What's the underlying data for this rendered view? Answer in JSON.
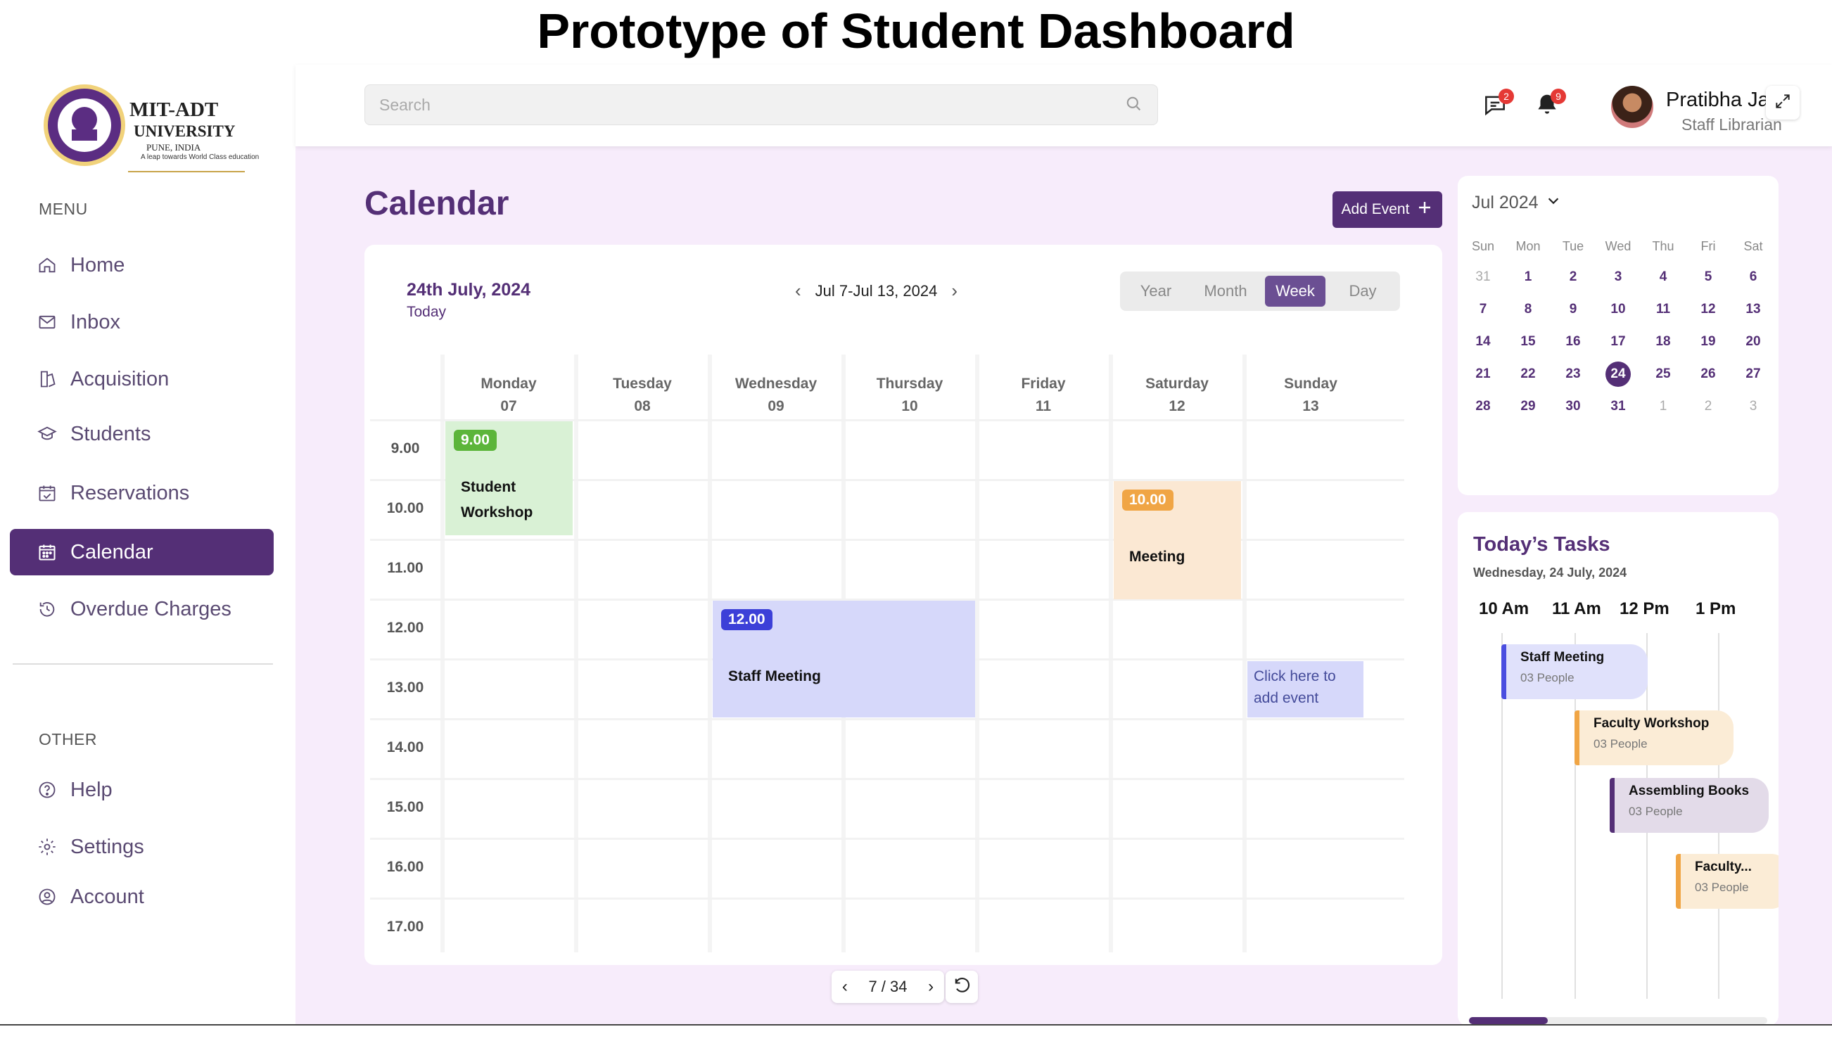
{
  "page_title": "Prototype of Student Dashboard",
  "logo": {
    "name_line1": "MIT-ADT",
    "name_line2": "UNIVERSITY",
    "location": "PUNE, INDIA",
    "tagline": "A leap towards World Class education",
    "seal_text": "MIT UNIVERSITY"
  },
  "sidebar": {
    "menu_heading": "MENU",
    "items": [
      {
        "label": "Home",
        "icon": "home-icon"
      },
      {
        "label": "Inbox",
        "icon": "mail-icon"
      },
      {
        "label": "Acquisition",
        "icon": "acquisition-icon"
      },
      {
        "label": "Students",
        "icon": "graduation-cap-icon"
      },
      {
        "label": "Reservations",
        "icon": "calendar-check-icon"
      },
      {
        "label": "Calendar",
        "icon": "calendar-icon",
        "active": true
      },
      {
        "label": "Overdue Charges",
        "icon": "clock-history-icon"
      }
    ],
    "other_heading": "OTHER",
    "other_items": [
      {
        "label": "Help",
        "icon": "help-icon"
      },
      {
        "label": "Settings",
        "icon": "gear-icon"
      },
      {
        "label": "Account",
        "icon": "user-circle-icon"
      }
    ]
  },
  "topbar": {
    "search_placeholder": "Search",
    "messages_count": "2",
    "notifications_count": "9",
    "user_name": "Pratibha Ja",
    "user_role": "Staff Librarian"
  },
  "calendar": {
    "title": "Calendar",
    "add_event_label": "Add Event",
    "current_date": "24th July, 2024",
    "today_label": "Today",
    "range_label": "Jul 7-Jul 13, 2024",
    "views": [
      "Year",
      "Month",
      "Week",
      "Day"
    ],
    "active_view": "Week",
    "days": [
      {
        "name": "Monday",
        "num": "07"
      },
      {
        "name": "Tuesday",
        "num": "08"
      },
      {
        "name": "Wednesday",
        "num": "09"
      },
      {
        "name": "Thursday",
        "num": "10"
      },
      {
        "name": "Friday",
        "num": "11"
      },
      {
        "name": "Saturday",
        "num": "12"
      },
      {
        "name": "Sunday",
        "num": "13"
      }
    ],
    "times": [
      "9.00",
      "10.00",
      "11.00",
      "12.00",
      "13.00",
      "14.00",
      "15.00",
      "16.00",
      "17.00"
    ],
    "events": [
      {
        "time": "9.00",
        "title_line1": "Student",
        "title_line2": "Workshop"
      },
      {
        "time": "10.00",
        "title_line1": "Meeting"
      },
      {
        "time": "12.00",
        "title_line1": "Staff Meeting"
      }
    ],
    "add_hint_line1": "Click here to",
    "add_hint_line2": "add event"
  },
  "pager": {
    "label": "7 / 34"
  },
  "mini_calendar": {
    "month_label": "Jul 2024",
    "dow": [
      "Sun",
      "Mon",
      "Tue",
      "Wed",
      "Thu",
      "Fri",
      "Sat"
    ],
    "weeks": [
      [
        "31",
        "1",
        "2",
        "3",
        "4",
        "5",
        "6"
      ],
      [
        "7",
        "8",
        "9",
        "10",
        "11",
        "12",
        "13"
      ],
      [
        "14",
        "15",
        "16",
        "17",
        "18",
        "19",
        "20"
      ],
      [
        "21",
        "22",
        "23",
        "24",
        "25",
        "26",
        "27"
      ],
      [
        "28",
        "29",
        "30",
        "31",
        "1",
        "2",
        "3"
      ]
    ],
    "selected": "24"
  },
  "tasks": {
    "title": "Today’s Tasks",
    "date": "Wednesday, 24 July, 2024",
    "hours": [
      "10 Am",
      "11 Am",
      "12 Pm",
      "1 Pm"
    ],
    "items": [
      {
        "name": "Staff Meeting",
        "people": "03 People"
      },
      {
        "name": "Faculty Workshop",
        "people": "03 People"
      },
      {
        "name": "Assembling Books",
        "people": "03 People"
      },
      {
        "name": "Faculty...",
        "people": "03 People"
      }
    ]
  },
  "colors": {
    "brand": "#542f76",
    "background": "#f7ecfb",
    "workshop": "#5cb53a",
    "meeting": "#f0a545",
    "staff_meeting": "#3c40d8"
  }
}
